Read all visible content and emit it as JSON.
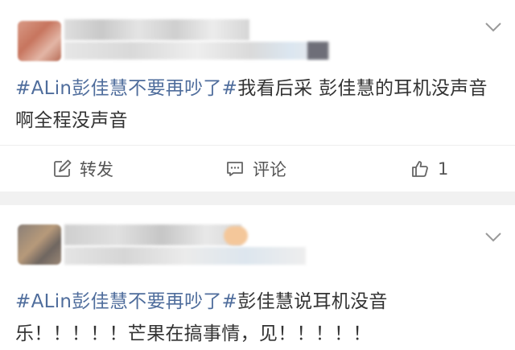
{
  "posts": [
    {
      "text_tag": "#ALin彭佳慧不要再吵了#",
      "text_body": "我看后采 彭佳慧的耳机没声音啊全程没声音",
      "actions": {
        "repost_label": "转发",
        "comment_label": "评论",
        "like_count": "1"
      }
    },
    {
      "text_tag": "#ALin彭佳慧不要再吵了#",
      "text_body": "彭佳慧说耳机没音乐！！！！！芒果在搞事情，见！！！！！"
    }
  ],
  "icons": {
    "repost": "share-edit-icon",
    "comment": "comment-icon",
    "like": "thumbs-up-icon",
    "expand": "chevron-down-icon"
  },
  "colors": {
    "tag": "#4f6d9c",
    "text": "#333333",
    "separator": "#f1f1f1"
  }
}
